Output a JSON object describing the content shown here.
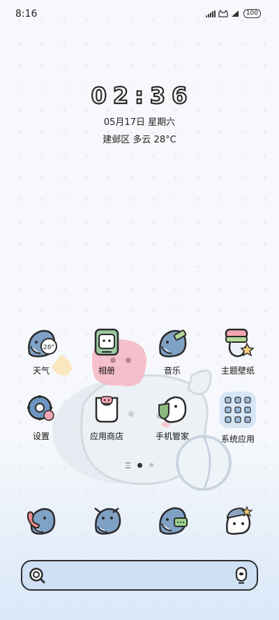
{
  "status_bar": {
    "time": "8:16",
    "battery": "100"
  },
  "clock": {
    "time": "02:36",
    "date": "05月17日 星期六",
    "weather": "建邺区 多云 28°C"
  },
  "weather_icon_temp": "28°",
  "apps": [
    {
      "label": "天气",
      "icon": "weather-icon"
    },
    {
      "label": "相册",
      "icon": "gallery-icon"
    },
    {
      "label": "音乐",
      "icon": "music-icon"
    },
    {
      "label": "主题壁纸",
      "icon": "themes-icon"
    },
    {
      "label": "设置",
      "icon": "settings-icon"
    },
    {
      "label": "应用商店",
      "icon": "app-store-icon"
    },
    {
      "label": "手机管家",
      "icon": "phone-manager-icon"
    },
    {
      "label": "系统应用",
      "icon": "system-apps-folder-icon"
    }
  ],
  "dock": [
    {
      "icon": "phone-icon"
    },
    {
      "icon": "contacts-icon"
    },
    {
      "icon": "messages-icon"
    },
    {
      "icon": "browser-icon"
    }
  ],
  "page_indicator": {
    "pages": 2,
    "active": 1
  },
  "colors": {
    "accent_pink": "#f5b8c6",
    "accent_blue": "#cfe0f4",
    "outline": "#2b2b2b"
  }
}
